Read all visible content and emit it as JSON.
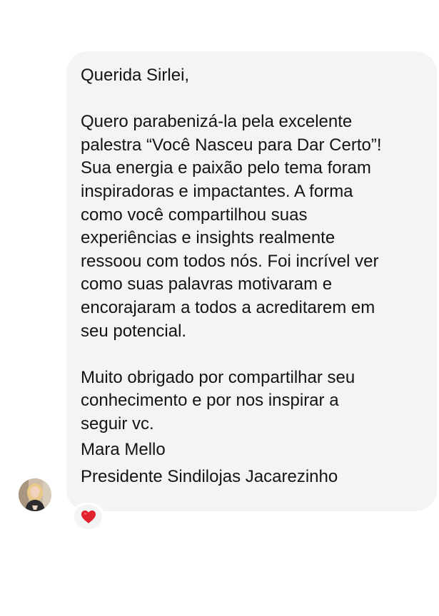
{
  "message": {
    "greeting": "Querida Sirlei,",
    "paragraph1_lines": [
      "Quero parabenizá-la pela excelente",
      "palestra “Você Nasceu para Dar Certo”!",
      "Sua energia e paixão pelo tema foram",
      "inspiradoras e impactantes. A forma",
      "como você compartilhou suas",
      "experiências e insights realmente",
      "ressoou com todos nós. Foi incrível ver",
      "como suas palavras motivaram e",
      "encorajaram a todos a acreditarem em",
      "seu potencial."
    ],
    "paragraph2_lines": [
      "Muito obrigado por compartilhar seu",
      "conhecimento e por nos inspirar a",
      "seguir vc."
    ],
    "signature_name": "Mara Mello",
    "signature_title": "Presidente Sindilojas Jacarezinho"
  },
  "reaction": {
    "icon": "red-heart-icon",
    "color": "#e0222e"
  },
  "avatar": {
    "icon": "sender-avatar"
  },
  "colors": {
    "bubble_background": "#f3f4f6",
    "text": "#141414"
  }
}
